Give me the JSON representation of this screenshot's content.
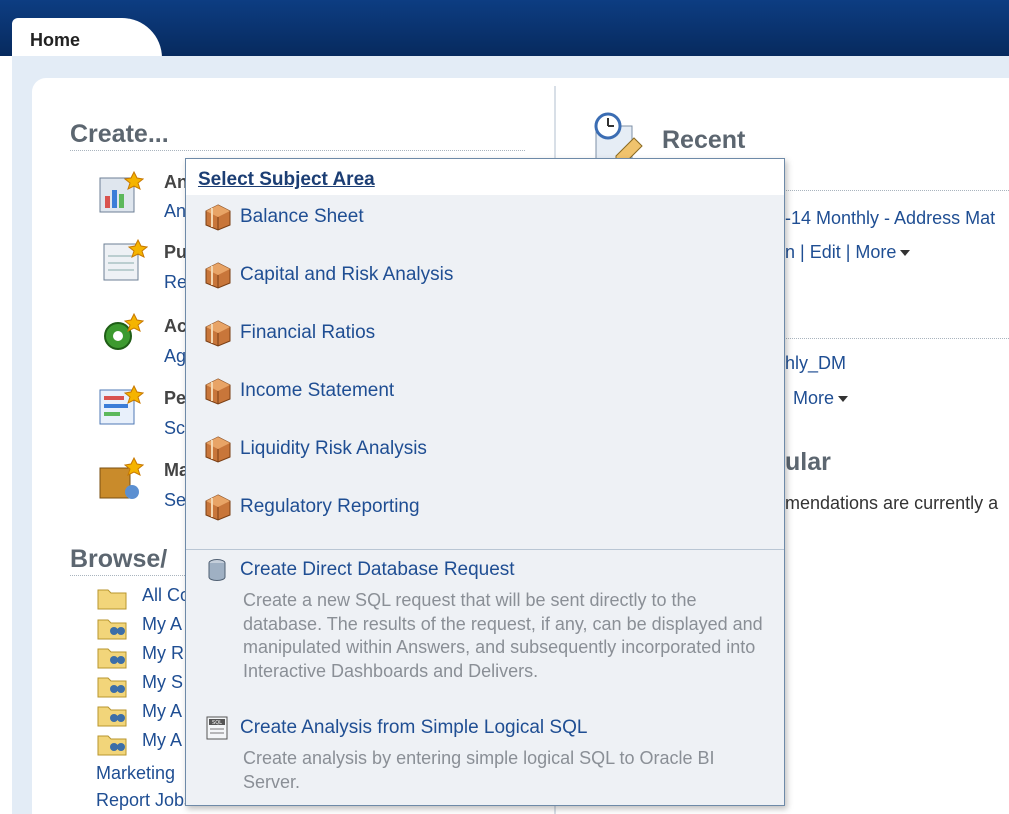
{
  "header": {
    "home_tab": "Home"
  },
  "create": {
    "title": "Create...",
    "items": [
      {
        "name": "analysis",
        "heading": "An",
        "sub": "An"
      },
      {
        "name": "publisher",
        "heading": "Pu",
        "sub": "Re"
      },
      {
        "name": "agent",
        "heading": "Ac",
        "sub": "Ag"
      },
      {
        "name": "performance",
        "heading": "Pe",
        "sub": "Sc"
      },
      {
        "name": "marketing",
        "heading": "Ma",
        "sub": "Se"
      }
    ]
  },
  "browse": {
    "title": "Browse/",
    "items": [
      "All Co",
      "My A",
      "My R",
      "My S",
      "My A",
      "My A"
    ],
    "links": [
      "Marketing",
      "Report Jobs"
    ]
  },
  "recent": {
    "title": "Recent",
    "item1_name": "-14 Monthly - Address Mat",
    "item1_actions": "n | Edit | More",
    "item2_name": "hly_DM",
    "item2_actions": "More",
    "popular_title": "ular",
    "popular_text": "mendations are currently a"
  },
  "popup": {
    "title": "Select Subject Area",
    "subject_areas": [
      "Balance Sheet",
      "Capital and Risk Analysis",
      "Financial Ratios",
      "Income Statement",
      "Liquidity Risk Analysis",
      "Regulatory Reporting"
    ],
    "direct_db": {
      "label": "Create Direct Database Request",
      "description": "Create a new SQL request that will be sent directly to the database. The results of the request, if any, can be displayed and manipulated within Answers, and subsequently incorporated into Interactive Dashboards and Delivers."
    },
    "logical_sql": {
      "label": "Create Analysis from Simple Logical SQL",
      "description": "Create analysis by entering simple logical SQL to Oracle BI Server."
    }
  }
}
